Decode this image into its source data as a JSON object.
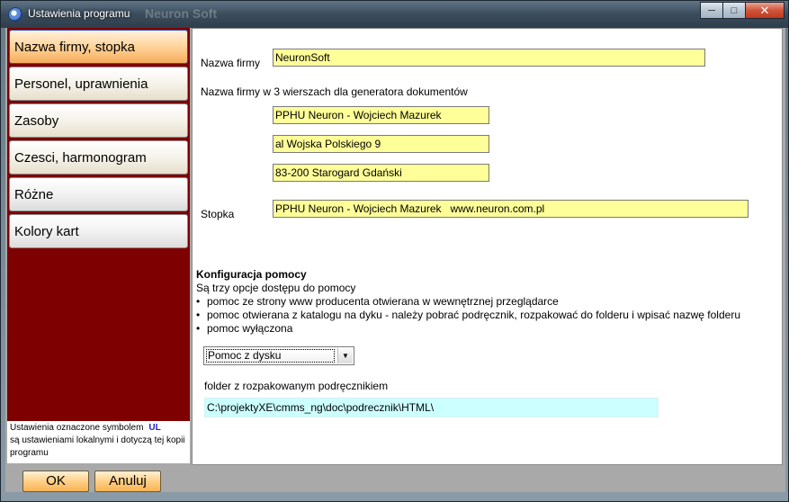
{
  "window": {
    "title": "Ustawienia programu",
    "ghost_text": "Neuron Soft"
  },
  "sidebar": {
    "items": [
      {
        "label": "Nazwa firmy, stopka"
      },
      {
        "label": "Personel, uprawnienia"
      },
      {
        "label": "Zasoby"
      },
      {
        "label": "Czesci, harmonogram"
      },
      {
        "label": "Różne"
      },
      {
        "label": "Kolory kart"
      }
    ],
    "note_line1": "Ustawienia oznaczone symbolem",
    "note_symbol": "UL",
    "note_rest": "są ustawieniami lokalnymi i dotyczą tej kopii programu"
  },
  "company": {
    "name_label": "Nazwa firmy",
    "name_value": "NeuronSoft",
    "lines_label": "Nazwa firmy w 3 wierszach dla generatora dokumentów",
    "line1": "PPHU Neuron - Wojciech Mazurek",
    "line2": "al Wojska Polskiego 9",
    "line3": "83-200 Starogard Gdański",
    "footer_label": "Stopka",
    "footer_value": "PPHU Neuron - Wojciech Mazurek   www.neuron.com.pl"
  },
  "help": {
    "heading": "Konfiguracja pomocy",
    "intro": "Są trzy opcje dostępu do pomocy",
    "options": [
      "pomoc ze strony www producenta otwierana w wewnętrznej przeglądarce",
      "pomoc otwierana z katalogu na dyku - należy pobrać podręcznik, rozpakować do folderu i wpisać nazwę folderu",
      "pomoc wyłączona"
    ],
    "selected": "Pomoc z dysku",
    "folder_label": "folder z rozpakowanym podręcznikiem",
    "folder_value": "C:\\projektyXE\\cmms_ng\\doc\\podrecznik\\HTML\\"
  },
  "buttons": {
    "ok": "OK",
    "cancel": "Anuluj"
  },
  "colors": {
    "sidebar_bg": "#7e0000",
    "field_yellow": "#ffff99",
    "field_cyan": "#ccffff",
    "button_orange": "#ffcf86"
  }
}
